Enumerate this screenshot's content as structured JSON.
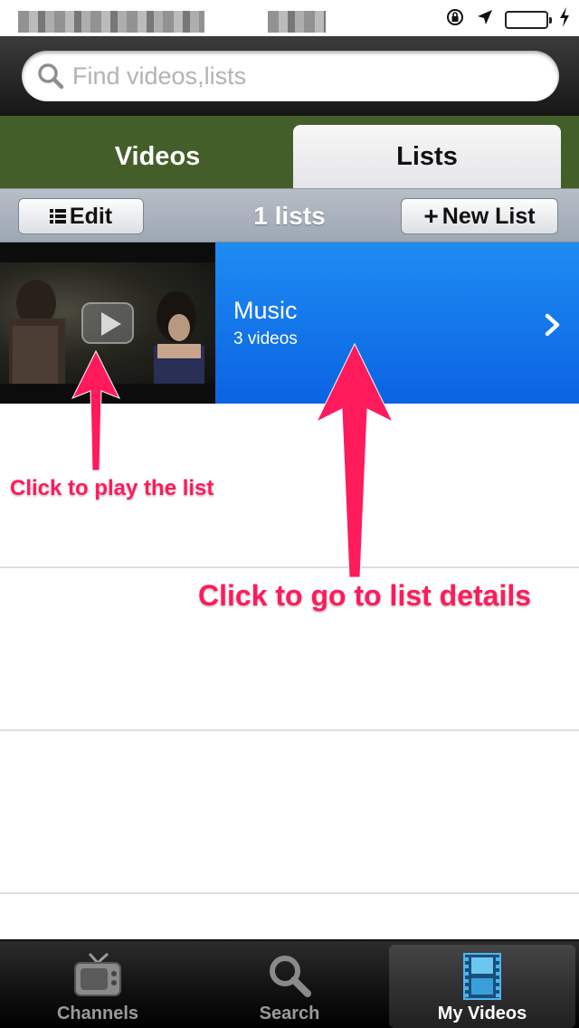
{
  "search": {
    "placeholder": "Find videos,lists"
  },
  "tabs": {
    "videos_label": "Videos",
    "lists_label": "Lists",
    "active": "Lists"
  },
  "toolbar": {
    "edit_label": "Edit",
    "count_label": "1 lists",
    "new_list_label": "New List"
  },
  "lists": [
    {
      "title": "Music",
      "subtitle": "3 videos"
    }
  ],
  "annotations": {
    "play": "Click to play the list",
    "details": "Click to go to list details"
  },
  "tabbar": {
    "items": [
      {
        "label": "Channels"
      },
      {
        "label": "Search"
      },
      {
        "label": "My Videos",
        "selected": true
      }
    ]
  },
  "colors": {
    "accent_blue": "#1a7ef0",
    "tabs_green": "#445e29",
    "annotation_pink": "#ff1a5b",
    "battery_green": "#4cd964"
  },
  "icons": {
    "status": [
      "orientation-lock-icon",
      "location-arrow-icon",
      "battery-icon",
      "charging-bolt-icon"
    ],
    "search": "magnifier-icon",
    "row": "chevron-right-icon",
    "thumbnail": "play-icon"
  }
}
